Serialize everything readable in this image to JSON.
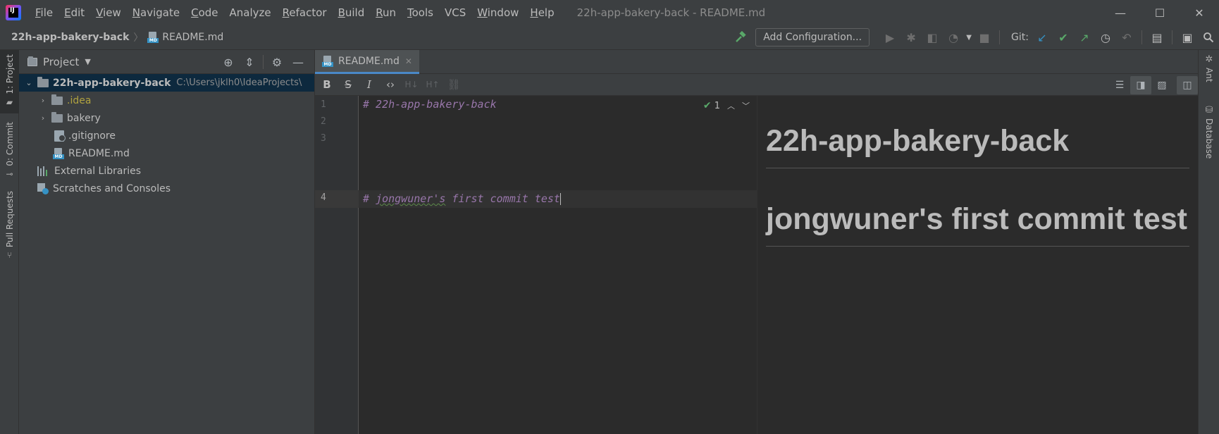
{
  "app": {
    "window_title": "22h-app-bakery-back - README.md",
    "logo_label": "IJ",
    "window_controls": {
      "minimize": "—",
      "maximize": "☐",
      "close": "✕"
    }
  },
  "menu": [
    {
      "mnemonic": "F",
      "rest": "ile"
    },
    {
      "mnemonic": "E",
      "rest": "dit"
    },
    {
      "mnemonic": "V",
      "rest": "iew"
    },
    {
      "mnemonic": "N",
      "rest": "avigate"
    },
    {
      "mnemonic": "C",
      "rest": "ode"
    },
    {
      "mnemonic": "",
      "rest": "Analyze"
    },
    {
      "mnemonic": "R",
      "rest": "efactor"
    },
    {
      "mnemonic": "B",
      "rest": "uild"
    },
    {
      "mnemonic": "R",
      "rest": "un"
    },
    {
      "mnemonic": "T",
      "rest": "ools"
    },
    {
      "mnemonic": "",
      "rest": "VCS"
    },
    {
      "mnemonic": "W",
      "rest": "indow"
    },
    {
      "mnemonic": "H",
      "rest": "elp"
    }
  ],
  "navbar": {
    "project": "22h-app-bakery-back",
    "file": "README.md",
    "add_configuration": "Add Configuration...",
    "git_label": "Git:"
  },
  "left_strip": {
    "project_tab": "1: Project",
    "commit_tab": "0: Commit",
    "pull_requests_tab": "Pull Requests"
  },
  "right_strip": {
    "ant_tab": "Ant",
    "database_tab": "Database"
  },
  "project_panel": {
    "title": "Project",
    "root": {
      "name": "22h-app-bakery-back",
      "path": "C:\\Users\\jklh0\\IdeaProjects\\"
    },
    "items": [
      {
        "name": ".idea"
      },
      {
        "name": "bakery"
      },
      {
        "name": ".gitignore"
      },
      {
        "name": "README.md"
      },
      {
        "name": "External Libraries"
      },
      {
        "name": "Scratches and Consoles"
      }
    ]
  },
  "editor": {
    "tab_label": "README.md",
    "lines": [
      {
        "num": "1",
        "text": "# 22h-app-bakery-back"
      },
      {
        "num": "2",
        "text": ""
      },
      {
        "num": "3",
        "text": ""
      },
      {
        "num": "4",
        "prefix": "# ",
        "squiggle": "jongwuner's",
        "suffix": " first commit test"
      }
    ],
    "inspection_count": "1"
  },
  "preview": {
    "headings": [
      "22h-app-bakery-back",
      "jongwuner's first commit test"
    ]
  },
  "colors": {
    "accent": "#4a88c7",
    "heading_markdown": "#9876aa",
    "check_green": "#59a869",
    "git_update_blue": "#3592c4"
  }
}
